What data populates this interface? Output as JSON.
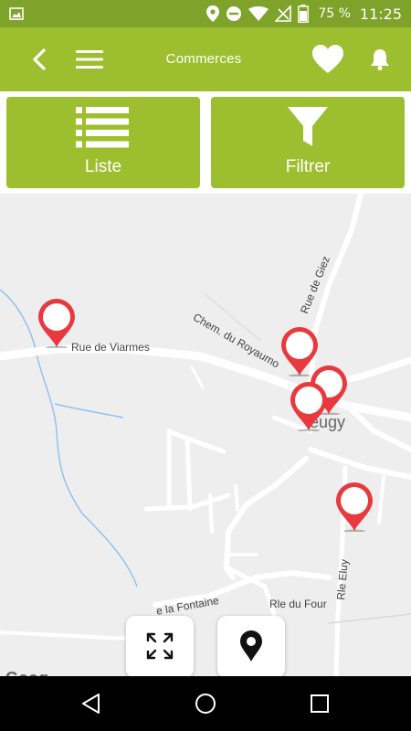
{
  "status_bar": {
    "battery_percent": "75 %",
    "time": "11:25",
    "icons": [
      "image-icon",
      "location-icon",
      "do-not-disturb-icon",
      "wifi-icon",
      "no-signal-icon",
      "battery-icon"
    ]
  },
  "app_bar": {
    "title": "Commerces",
    "icons": [
      "back-arrow-icon",
      "hamburger-menu-icon",
      "heart-icon",
      "bell-icon"
    ]
  },
  "actions": {
    "list_label": "Liste",
    "filter_label": "Filtrer"
  },
  "map": {
    "street_labels": {
      "rue_de_viarmes": "Rue de Viarmes",
      "chem_du_royaumont": "Chem. du Royaumo",
      "rue_de_giez": "Rue de Giez",
      "town": "eugy",
      "rue_la_fontaine": "e la Fontaine",
      "rle_du_four": "Rle du Four",
      "rle_eluy": "Rle Eluy"
    },
    "marker_count": 5,
    "controls": [
      "expand-icon",
      "location-pin-icon"
    ],
    "logo_text": "Goog"
  },
  "colors": {
    "status_bar": "#7ea22a",
    "app_bar": "#9dbf2f",
    "marker": "#e8393f",
    "map_bg": "#eeeeee",
    "water": "#8fc3ee"
  }
}
